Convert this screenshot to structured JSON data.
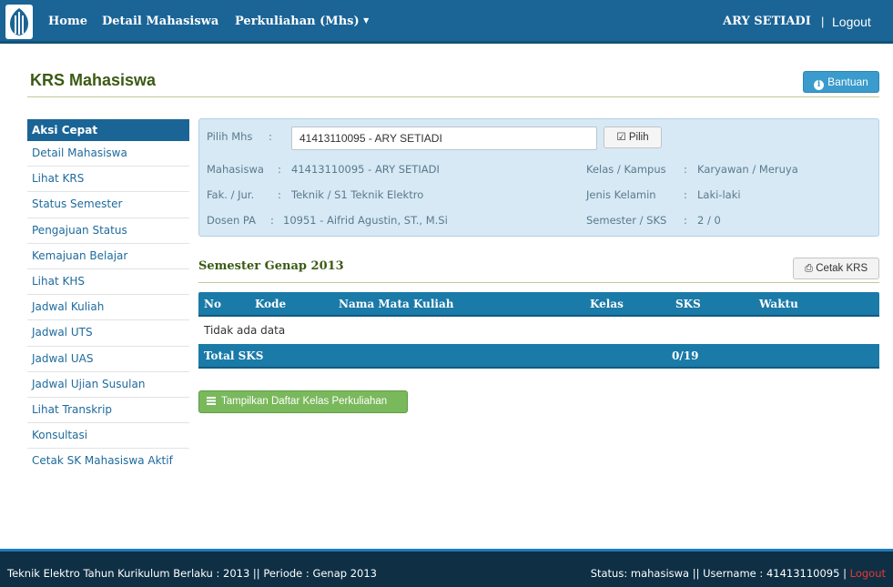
{
  "nav": {
    "home": "Home",
    "detail": "Detail Mahasiswa",
    "perkuliahan": "Perkuliahan (Mhs)",
    "user": "ARY SETIADI",
    "separator": "|",
    "logout": "Logout"
  },
  "page": {
    "title": "KRS Mahasiswa",
    "help_button": "Bantuan"
  },
  "sidebar": {
    "title": "Aksi Cepat",
    "items": [
      "Detail Mahasiswa",
      "Lihat KRS",
      "Status Semester",
      "Pengajuan Status",
      "Kemajuan Belajar",
      "Lihat KHS",
      "Jadwal Kuliah",
      "Jadwal UTS",
      "Jadwal UAS",
      "Jadwal Ujian Susulan",
      "Lihat Transkrip",
      "Konsultasi",
      "Cetak SK Mahasiswa Aktif"
    ]
  },
  "panel": {
    "pick_label": "Pilih Mhs",
    "pick_value": "41413110095 - ARY SETIADI",
    "pick_button": "Pilih",
    "mahasiswa_label": "Mahasiswa",
    "mahasiswa_value": "41413110095 - ARY SETIADI",
    "fakjur_label": "Fak. / Jur.",
    "fakjur_value": "Teknik / S1 Teknik Elektro",
    "dosen_label": "Dosen PA",
    "dosen_value": "10951 - Aifrid Agustin, ST., M.Si",
    "kelas_label": "Kelas / Kampus",
    "kelas_value": "Karyawan / Meruya",
    "jk_label": "Jenis Kelamin",
    "jk_value": "Laki-laki",
    "sem_label": "Semester / SKS",
    "sem_value": "2 / 0",
    "colon": ":"
  },
  "semester": {
    "title": "Semester Genap 2013",
    "print_button": "Cetak KRS"
  },
  "table": {
    "headers": {
      "no": "No",
      "kode": "Kode",
      "nama": "Nama Mata Kuliah",
      "kelas": "Kelas",
      "sks": "SKS",
      "waktu": "Waktu"
    },
    "empty": "Tidak ada data",
    "total_label": "Total SKS",
    "total_value": "0/19"
  },
  "show_classes_button": "Tampilkan Daftar Kelas Perkuliahan",
  "footer": {
    "left": "Teknik Elektro  Tahun Kurikulum Berlaku : 2013  ||  Periode : Genap 2013",
    "right": "Status: mahasiswa || Username : 41413110095 | ",
    "logout": "Logout"
  },
  "colors": {
    "navbar": "#1a6496",
    "title_green": "#3c5a14",
    "panel_bg": "#d7e9f5",
    "table_header": "#1a7aa8",
    "button_green": "#7ab85c",
    "footer_bg": "#0e2f44",
    "logout_red": "#e53935"
  }
}
